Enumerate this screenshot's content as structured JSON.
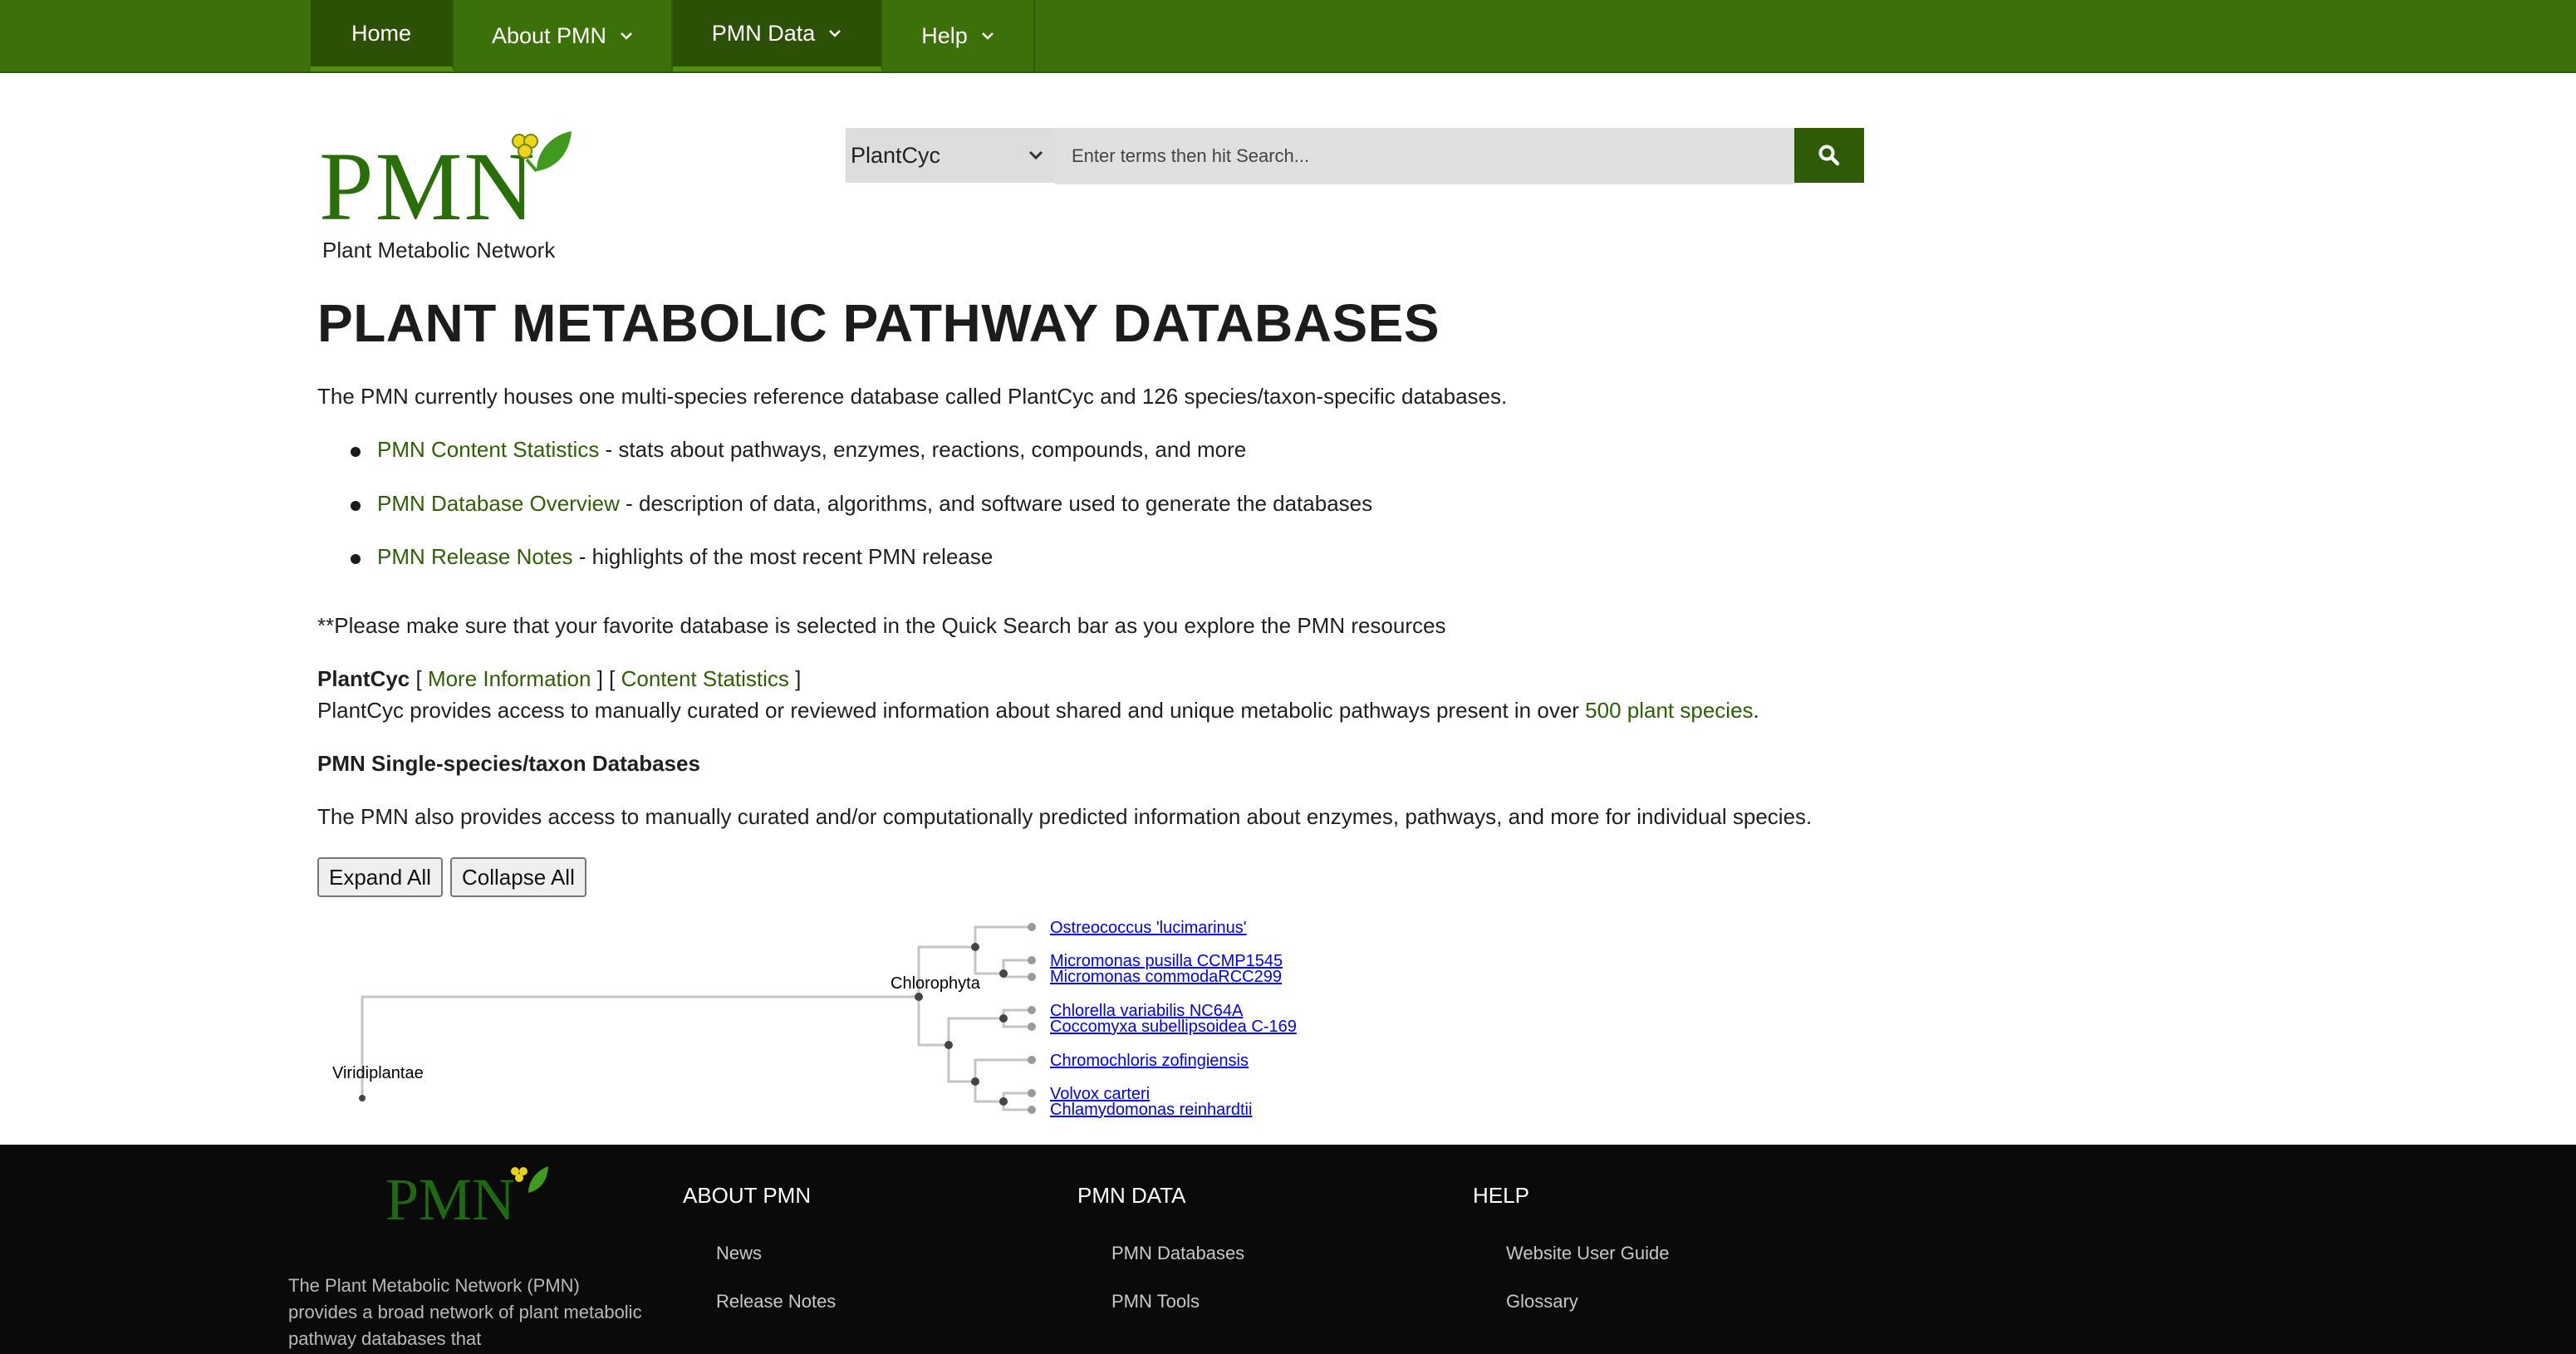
{
  "nav": {
    "items": [
      {
        "label": "Home"
      },
      {
        "label": "About PMN"
      },
      {
        "label": "PMN Data"
      },
      {
        "label": "Help"
      }
    ]
  },
  "logo": {
    "wordmark": "PMN",
    "tagline": "Plant Metabolic Network"
  },
  "search": {
    "selected_db": "PlantCyc",
    "placeholder": "Enter terms then hit Search..."
  },
  "main": {
    "title": "PLANT METABOLIC PATHWAY DATABASES",
    "intro": "The PMN currently houses one multi-species reference database called PlantCyc and 126 species/taxon-specific databases.",
    "links": [
      {
        "link": "PMN Content Statistics",
        "text": " - stats about pathways, enzymes, reactions, compounds, and more"
      },
      {
        "link": "PMN Database Overview",
        "text": " - description of data, algorithms, and software used to generate the databases"
      },
      {
        "link": "PMN Release Notes",
        "text": " - highlights of the most recent PMN release"
      }
    ],
    "note": "**Please make sure that your favorite database is selected in the Quick Search bar as you explore the PMN resources",
    "plantcyc": {
      "name": "PlantCyc",
      "bracket_open": " [ ",
      "more_info": "More Information",
      "bracket_mid": " ] [ ",
      "content_stats": "Content Statistics",
      "bracket_close": " ]",
      "desc": "PlantCyc provides access to manually curated or reviewed information about shared and unique metabolic pathways present in over ",
      "species_link": "500 plant species",
      "desc_end": "."
    },
    "single_heading": "PMN Single-species/taxon Databases",
    "single_desc": "The PMN also provides access to manually curated and/or computationally predicted information about enzymes, pathways, and more for individual species.",
    "expand_label": "Expand All",
    "collapse_label": "Collapse All"
  },
  "tree": {
    "nodes": [
      "Viridiplantae",
      "Chlorophyta"
    ],
    "leaves": [
      "Ostreococcus 'lucimarinus'",
      "Micromonas pusilla CCMP1545",
      "Micromonas commodaRCC299",
      "Chlorella variabilis NC64A",
      "Coccomyxa subellipsoidea C-169",
      "Chromochloris zofingiensis",
      "Volvox carteri",
      "Chlamydomonas reinhardtii"
    ]
  },
  "footer": {
    "logo_text": "PMN",
    "description": "The Plant Metabolic Network (PMN) provides a broad network of plant metabolic pathway databases that",
    "columns": [
      {
        "title": "ABOUT PMN",
        "links": [
          "News",
          "Release Notes"
        ]
      },
      {
        "title": "PMN DATA",
        "links": [
          "PMN Databases",
          "PMN Tools"
        ]
      },
      {
        "title": "HELP",
        "links": [
          "Website User Guide",
          "Glossary"
        ]
      }
    ]
  },
  "colors": {
    "brand_green": "#3c7009",
    "dark_green": "#2b5006",
    "link_green": "#2f5e06",
    "tree_link": "#0000ee"
  }
}
